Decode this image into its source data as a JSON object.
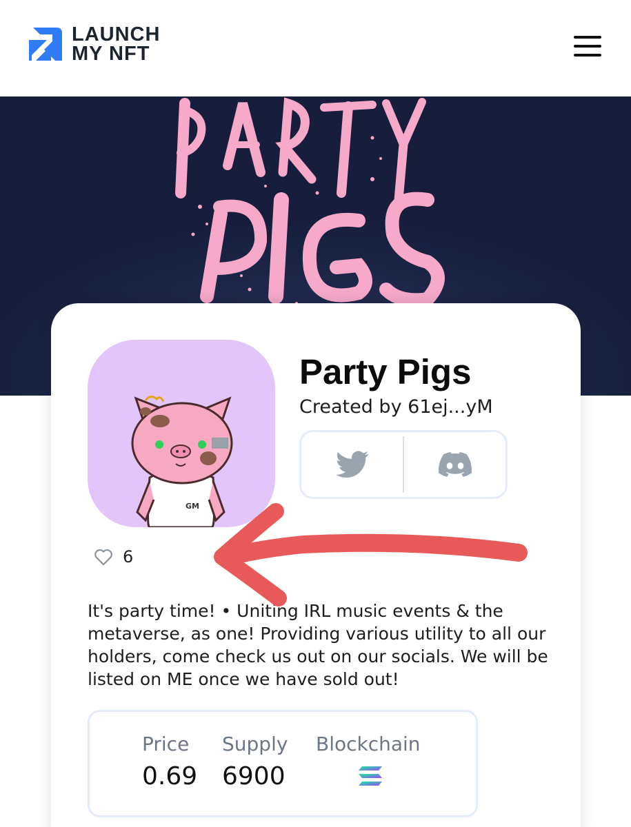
{
  "header": {
    "logo_line1": "LAUNCH",
    "logo_line2": "MY NFT",
    "logo_icon": "launch-my-nft-logo-icon",
    "menu_icon": "hamburger-menu-icon"
  },
  "banner": {
    "artwork": "party-pigs-banner-artwork"
  },
  "collection": {
    "name": "Party Pigs",
    "creator": "Created by 61ej...yM",
    "avatar": "party-pig-avatar",
    "likes": "6",
    "description": "It's party time! • Uniting IRL music events & the metaverse, as one! Providing various utility to all our holders, come check us out on our socials. We will be listed on ME once we have sold out!"
  },
  "socials": [
    {
      "icon": "twitter-icon"
    },
    {
      "icon": "discord-icon"
    }
  ],
  "stats": {
    "price_label": "Price",
    "price_value": "0.69",
    "supply_label": "Supply",
    "supply_value": "6900",
    "blockchain_label": "Blockchain",
    "blockchain_icon": "solana-icon"
  },
  "colors": {
    "banner_bg": "#161e3b",
    "banner_text": "#f6a9c9",
    "logo_blue": "#2f7cf6",
    "avatar_bg": "#e2c5fa",
    "annotation_arrow": "#e85a5a",
    "social_icon": "#9aa4ae"
  }
}
